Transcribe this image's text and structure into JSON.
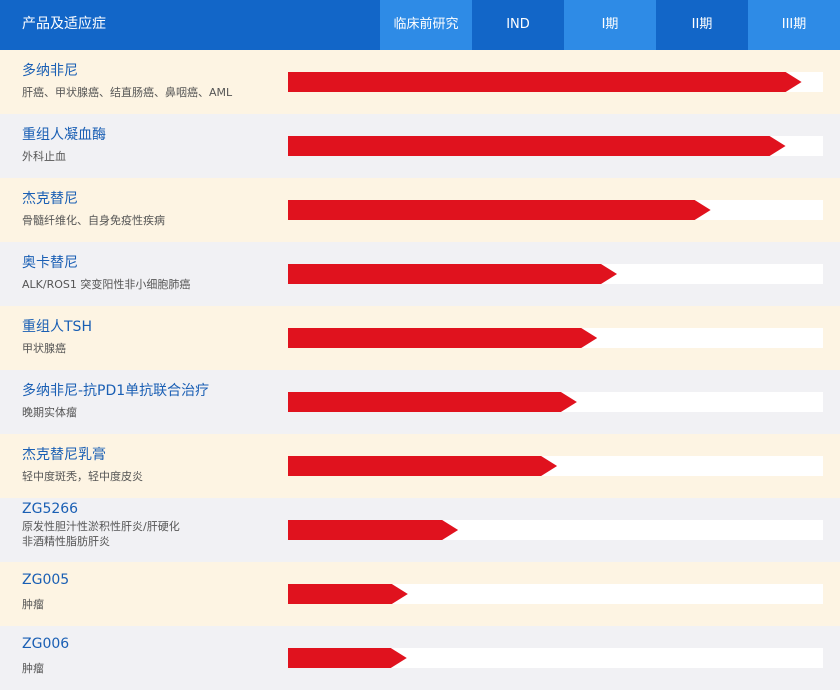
{
  "header": {
    "title": "产品及适应症",
    "phases": [
      "临床前研究",
      "IND",
      "I期",
      "II期",
      "III期"
    ]
  },
  "colors": {
    "header_dark": "#1266c8",
    "header_light": "#2e8be6",
    "arrow": "#e0121e",
    "name_text": "#1a5fb4",
    "row_odd": "#fdf4e3",
    "row_even": "#f1f1f4"
  },
  "products": [
    {
      "name": "多纳非尼",
      "indication": "肝癌、甲状腺癌、结直肠癌、鼻咽癌、AML",
      "progress": 0.96
    },
    {
      "name": "重组人凝血酶",
      "indication": "外科止血",
      "progress": 0.93
    },
    {
      "name": "杰克替尼",
      "indication": "骨髓纤维化、自身免疫性疾病",
      "progress": 0.79
    },
    {
      "name": "奥卡替尼",
      "indication": "ALK/ROS1 突变阳性非小细胞肺癌",
      "progress": 0.615
    },
    {
      "name": "重组人TSH",
      "indication": "甲状腺癌",
      "progress": 0.578
    },
    {
      "name": "多纳非尼-抗PD1单抗联合治疗",
      "indication": "晚期实体瘤",
      "progress": 0.54
    },
    {
      "name": "杰克替尼乳膏",
      "indication": "轻中度斑秃，轻中度皮炎",
      "progress": 0.503
    },
    {
      "name": "ZG5266",
      "indication": "原发性胆汁性淤积性肝炎/肝硬化",
      "indication2": "非酒精性脂肪肝炎",
      "progress": 0.318
    },
    {
      "name": "ZG005",
      "indication": "肿瘤",
      "progress": 0.224
    },
    {
      "name": "ZG006",
      "indication": "肿瘤",
      "progress": 0.222
    }
  ]
}
